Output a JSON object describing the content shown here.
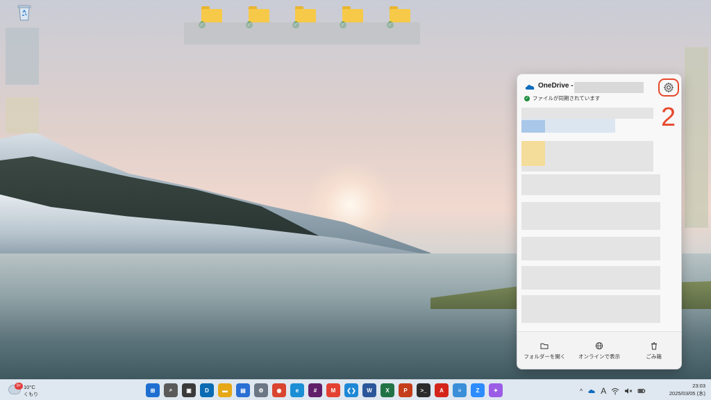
{
  "onedrive": {
    "title": "OneDrive -",
    "status": "ファイルが同期されています",
    "footer": {
      "open_folder": "フォルダーを開く",
      "view_online": "オンラインで表示",
      "recycle_bin": "ごみ箱"
    },
    "accent_color": "#0f6cbd"
  },
  "annotation": {
    "step_number": "2",
    "color": "#e6482c"
  },
  "taskbar": {
    "weather": {
      "temperature": "10°C",
      "condition": "くもり",
      "badge": "9+"
    },
    "apps": [
      {
        "name": "start",
        "color": "#1f6fd1",
        "glyph": "⊞"
      },
      {
        "name": "search",
        "color": "#5a5a5a",
        "glyph": "⌕"
      },
      {
        "name": "task-view",
        "color": "#3a3a3a",
        "glyph": "▣"
      },
      {
        "name": "dell",
        "color": "#0a6bb3",
        "glyph": "D"
      },
      {
        "name": "file-explorer",
        "color": "#e6a817",
        "glyph": "▬"
      },
      {
        "name": "store",
        "color": "#2a6fd4",
        "glyph": "▤"
      },
      {
        "name": "settings",
        "color": "#6b7785",
        "glyph": "⚙"
      },
      {
        "name": "chrome",
        "color": "#d9452f",
        "glyph": "◉"
      },
      {
        "name": "edge",
        "color": "#1b8fd6",
        "glyph": "e"
      },
      {
        "name": "slack",
        "color": "#611f69",
        "glyph": "#"
      },
      {
        "name": "gmail",
        "color": "#e34133",
        "glyph": "M"
      },
      {
        "name": "vscode",
        "color": "#1f88d6",
        "glyph": "❮❯"
      },
      {
        "name": "word",
        "color": "#2b579a",
        "glyph": "W"
      },
      {
        "name": "excel",
        "color": "#217346",
        "glyph": "X"
      },
      {
        "name": "powerpoint",
        "color": "#c43e1c",
        "glyph": "P"
      },
      {
        "name": "terminal",
        "color": "#2b2b2b",
        "glyph": ">_"
      },
      {
        "name": "acrobat",
        "color": "#d4251b",
        "glyph": "A"
      },
      {
        "name": "notepad",
        "color": "#3a8fd8",
        "glyph": "≡"
      },
      {
        "name": "zoom",
        "color": "#2d8cff",
        "glyph": "Z"
      },
      {
        "name": "copilot",
        "color": "#9b5de5",
        "glyph": "✦"
      }
    ],
    "tray": {
      "chevron": "^",
      "ime": "A"
    },
    "clock": {
      "time": "23:03",
      "date": "2025/03/05 (水)"
    }
  }
}
